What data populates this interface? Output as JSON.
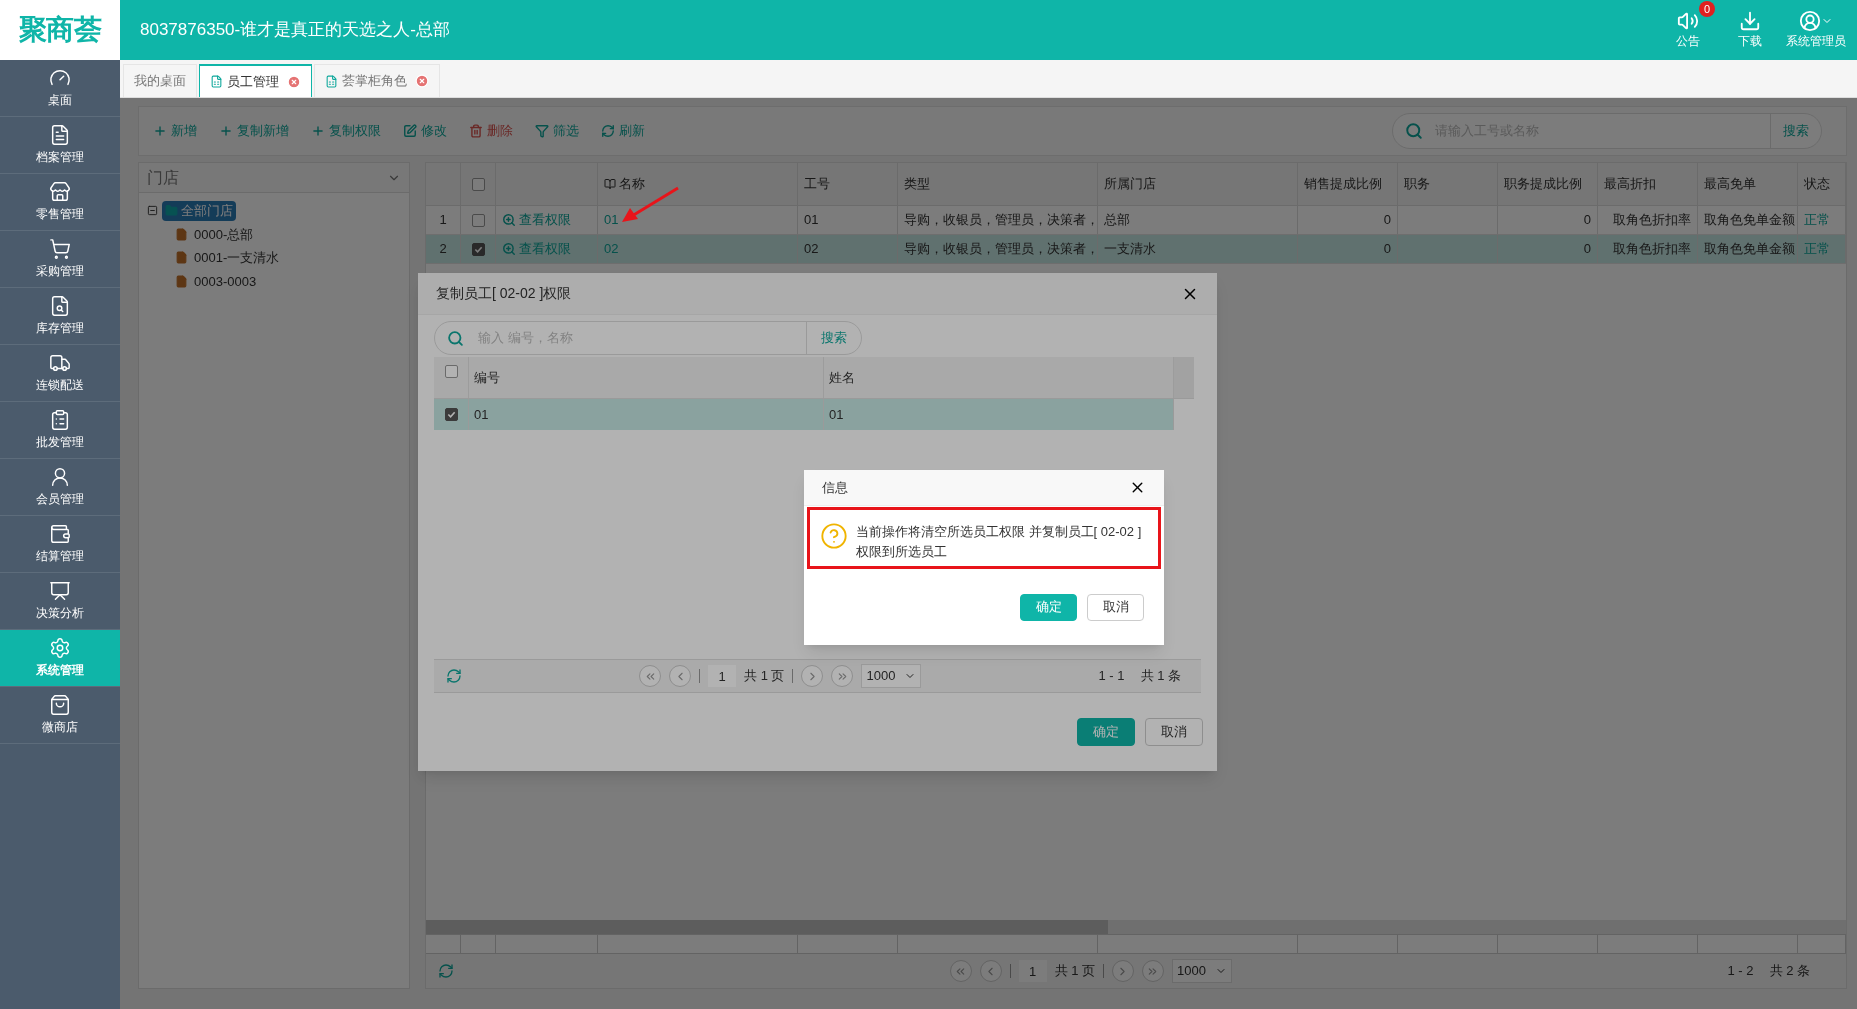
{
  "header": {
    "logo": "聚商荟",
    "title": "8037876350-谁才是真正的天选之人-总部",
    "actions": [
      {
        "kind": "notice",
        "label": "公告",
        "badge": "0"
      },
      {
        "kind": "download",
        "label": "下载"
      },
      {
        "kind": "user",
        "label": "系统管理员"
      }
    ]
  },
  "sidebar": {
    "items": [
      {
        "label": "桌面",
        "selected": false
      },
      {
        "label": "档案管理",
        "selected": false
      },
      {
        "label": "零售管理",
        "selected": false
      },
      {
        "label": "采购管理",
        "selected": false
      },
      {
        "label": "库存管理",
        "selected": false
      },
      {
        "label": "连锁配送",
        "selected": false
      },
      {
        "label": "批发管理",
        "selected": false
      },
      {
        "label": "会员管理",
        "selected": false
      },
      {
        "label": "结算管理",
        "selected": false
      },
      {
        "label": "决策分析",
        "selected": false
      },
      {
        "label": "系统管理",
        "selected": true
      },
      {
        "label": "微商店",
        "selected": false
      }
    ]
  },
  "tabs": [
    {
      "label": "我的桌面",
      "selected": false,
      "closable": false
    },
    {
      "label": "员工管理",
      "selected": true,
      "closable": true
    },
    {
      "label": "荟掌柜角色",
      "selected": false,
      "closable": true
    }
  ],
  "toolbar": {
    "buttons": [
      {
        "label": "新增"
      },
      {
        "label": "复制新增"
      },
      {
        "label": "复制权限"
      },
      {
        "label": "修改"
      },
      {
        "label": "删除"
      },
      {
        "label": "筛选"
      },
      {
        "label": "刷新"
      }
    ],
    "search": {
      "placeholder": "请输入工号或名称",
      "button": "搜索"
    }
  },
  "store_tree": {
    "title": "门店",
    "root": {
      "label": "全部门店",
      "expanded": true,
      "selected": true,
      "children": [
        {
          "label": "0000-总部"
        },
        {
          "label": "0001-一支清水"
        },
        {
          "label": "0003-0003"
        }
      ]
    }
  },
  "table": {
    "all_checked": false,
    "columns": [
      "名称",
      "工号",
      "类型",
      "所属门店",
      "销售提成比例",
      "职务",
      "职务提成比例",
      "最高折扣",
      "最高免单",
      "状态"
    ],
    "rows": [
      {
        "index": "1",
        "checked": false,
        "selected": false,
        "action": "查看权限",
        "cells": [
          "01",
          "01",
          "导购，收银员，管理员，决策者，",
          "总部",
          "0",
          "",
          "0",
          "取角色折扣率",
          "取角色免单金额",
          "正常"
        ]
      },
      {
        "index": "2",
        "checked": true,
        "selected": true,
        "action": "查看权限",
        "cells": [
          "02",
          "02",
          "导购，收银员，管理员，决策者，",
          "一支清水",
          "0",
          "",
          "0",
          "取角色折扣率",
          "取角色免单金额",
          "正常"
        ]
      }
    ],
    "pager": {
      "page": "1",
      "pages": "共 1 页",
      "size": "1000",
      "range": "1 - 2",
      "total": "共 2 条"
    }
  },
  "dialog": {
    "title": "复制员工[ 02-02 ]权限",
    "search": {
      "placeholder": "输入 编号，名称",
      "button": "搜索"
    },
    "all_checked": false,
    "columns": [
      "编号",
      "姓名"
    ],
    "rows": [
      {
        "checked": true,
        "selected": true,
        "cells": [
          "01",
          "01"
        ]
      }
    ],
    "pager": {
      "page": "1",
      "pages": "共 1 页",
      "size": "1000",
      "range": "1 - 1",
      "total": "共 1 条"
    },
    "buttons": [
      {
        "kind": "primary",
        "label": "确定"
      },
      {
        "kind": "default",
        "label": "取消"
      }
    ]
  },
  "message": {
    "title": "信息",
    "text": "当前操作将清空所选员工权限 并复制员工[ 02-02 ]权限到所选员工",
    "buttons": [
      {
        "kind": "primary",
        "label": "确定"
      },
      {
        "kind": "default",
        "label": "取消"
      }
    ]
  }
}
